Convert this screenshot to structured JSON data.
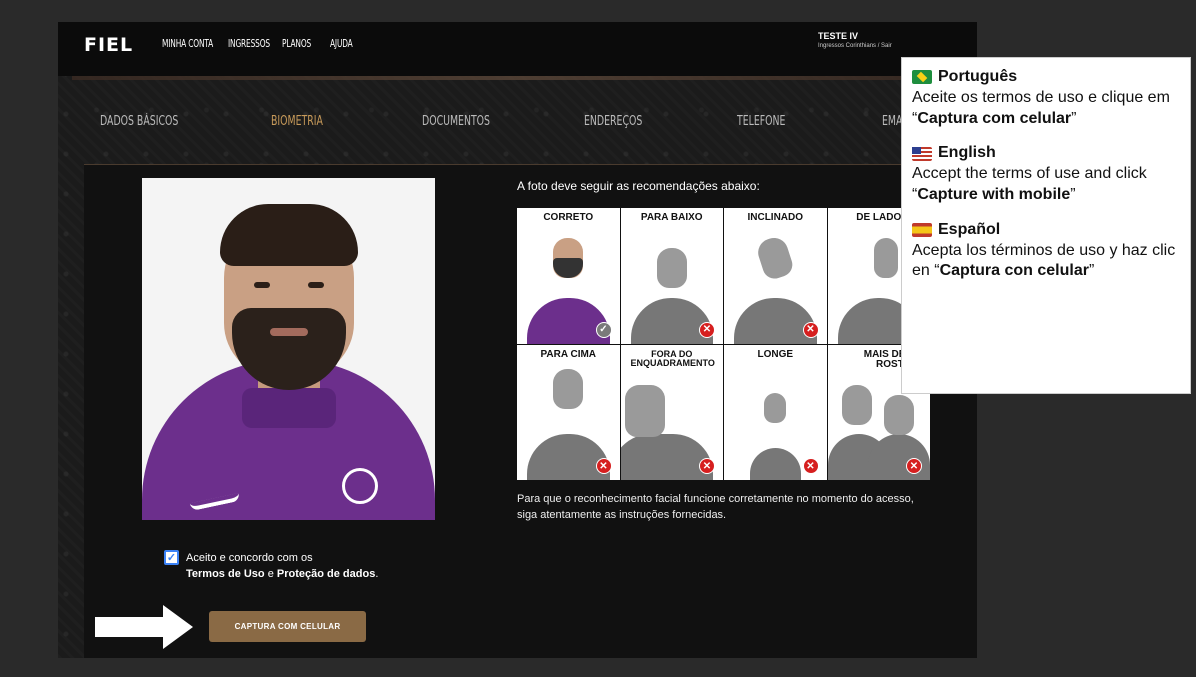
{
  "header": {
    "logo": "FIEL",
    "nav": [
      "MINHA CONTA",
      "INGRESSOS",
      "PLANOS",
      "AJUDA"
    ],
    "user_name": "TESTE IV",
    "user_links": "Ingressos Corinthians / Sair"
  },
  "steps": [
    {
      "label": "DADOS BÁSICOS",
      "active": false
    },
    {
      "label": "BIOMETRIA",
      "active": true
    },
    {
      "label": "DOCUMENTOS",
      "active": false
    },
    {
      "label": "ENDEREÇOS",
      "active": false
    },
    {
      "label": "TELEFONE",
      "active": false
    },
    {
      "label": "EMAIL",
      "active": false
    }
  ],
  "recommendations": {
    "title": "A foto deve seguir as recomendações abaixo:",
    "examples": [
      {
        "label": "CORRETO",
        "status": "ok"
      },
      {
        "label": "PARA BAIXO",
        "status": "bad"
      },
      {
        "label": "INCLINADO",
        "status": "bad"
      },
      {
        "label": "DE LADO",
        "status": "bad"
      },
      {
        "label": "PARA CIMA",
        "status": "bad"
      },
      {
        "label": "FORA DO ENQUADRAMENTO",
        "status": "bad"
      },
      {
        "label": "LONGE",
        "status": "bad"
      },
      {
        "label": "MAIS DE UM ROSTO",
        "status": "bad"
      }
    ],
    "note": "Para que o reconhecimento facial funcione corretamente no momento do acesso, siga atentamente as instruções fornecidas."
  },
  "consent": {
    "checked": true,
    "line1": "Aceito e concordo com os",
    "terms_link": "Termos de Uso",
    "connector": "e",
    "privacy_link": "Proteção de dados",
    "end": "."
  },
  "capture_button": "CAPTURA COM CELULAR",
  "instructions_overlay": {
    "pt": {
      "heading": "Português",
      "before": "Aceite os termos de uso e clique em “",
      "bold": "Captura com celular",
      "after": "”"
    },
    "en": {
      "heading": "English",
      "before": "Accept the terms of use and click “",
      "bold": "Capture with mobile",
      "after": "”"
    },
    "es": {
      "heading": "Español",
      "before": "Acepta los términos de uso y haz clic en “",
      "bold": "Captura con celular",
      "after": "”"
    }
  },
  "colors": {
    "accent": "#c79a5a",
    "button": "#8a6a45",
    "error_badge": "#d61f1f",
    "jersey": "#6c2f8c"
  }
}
